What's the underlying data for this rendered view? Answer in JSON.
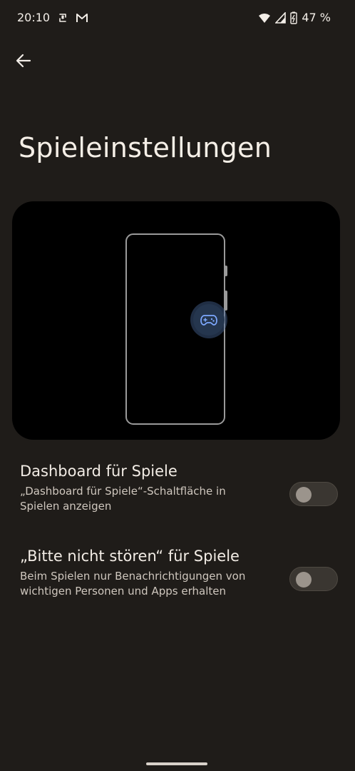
{
  "status_bar": {
    "time": "20:10",
    "battery_percent": "47 %",
    "left_icons": [
      "sync-icon",
      "gmail-icon"
    ],
    "right_icons": [
      "wifi-icon",
      "signal-icon",
      "battery-charging-icon"
    ]
  },
  "header": {
    "back_icon": "arrow-left-icon",
    "title": "Spieleinstellungen"
  },
  "preview": {
    "icon": "game-controller-icon"
  },
  "settings": [
    {
      "title": "Dashboard für Spiele",
      "description": "„Dashboard für Spiele“-Schaltfläche in Spielen anzeigen",
      "enabled": false
    },
    {
      "title": "„Bitte nicht stören“ für Spiele",
      "description": "Beim Spielen nur Benachrichtigungen von wichtigen Personen und Apps erhalten",
      "enabled": false
    }
  ],
  "colors": {
    "background": "#1f1c19",
    "toggle_track": "#3a3631",
    "toggle_thumb": "#9b948c",
    "game_bubble": "#25364e"
  }
}
